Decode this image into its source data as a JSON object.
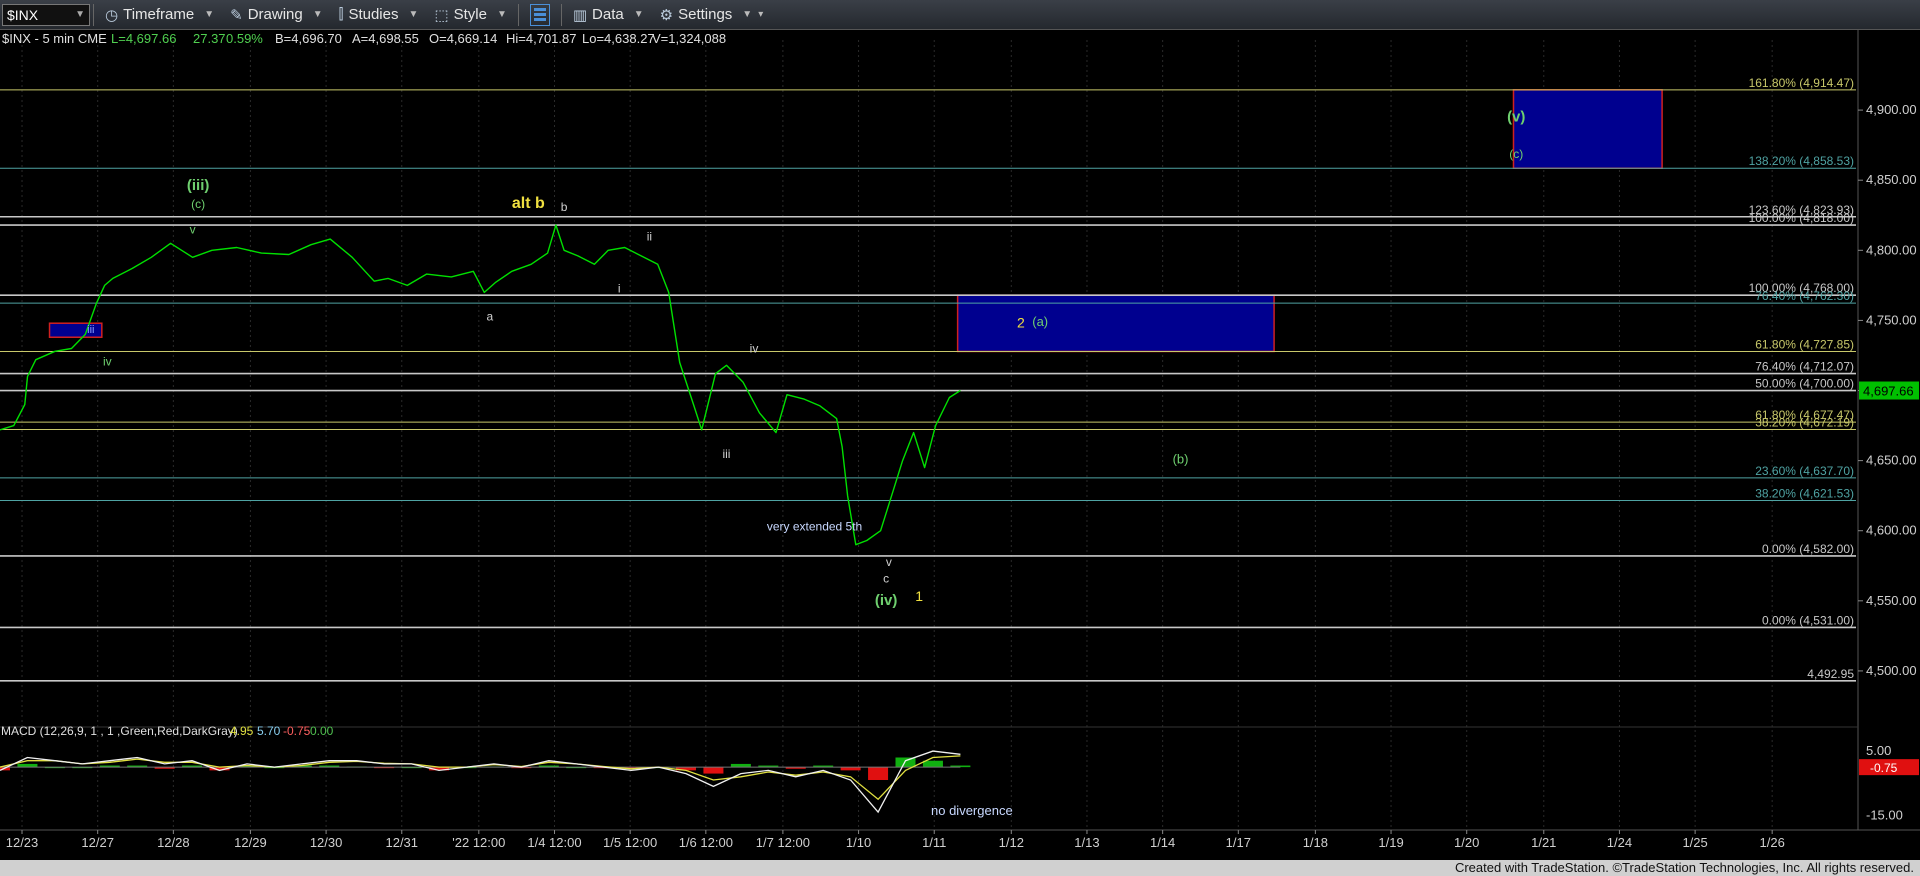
{
  "toolbar": {
    "symbol": "$INX",
    "timeframe": "Timeframe",
    "drawing": "Drawing",
    "studies": "Studies",
    "style": "Style",
    "data": "Data",
    "settings": "Settings"
  },
  "header": {
    "symbol_info": "$INX - 5 min  CME",
    "last": "L=4,697.66",
    "change": "27.37",
    "pct": "0.59%",
    "bid": "B=4,696.70",
    "ask": "A=4,698.55",
    "open": "O=4,669.14",
    "hi": "Hi=4,701.87",
    "lo": "Lo=4,638.27",
    "vol": "V=1,324,088"
  },
  "footer": "Created with TradeStation. ©TradeStation Technologies, Inc. All rights reserved.",
  "colors": {
    "price": "#00e000",
    "axis_text": "#d0d0d0",
    "fib_gray": "#c8c8c8",
    "fib_olive": "#c8c86a",
    "fib_teal": "#4fa3a3",
    "box_fill": "#00008f",
    "box_border": "#d02020"
  },
  "chart_data": [
    {
      "type": "line",
      "title": "",
      "price_axis": {
        "ylim": [
          4465,
          4950
        ],
        "ticks": [
          4900,
          4850,
          4800,
          4750,
          4700,
          4650,
          4600,
          4550,
          4500
        ],
        "tick_labels": [
          "4,900.00",
          "4,850.00",
          "4,800.00",
          "4,750.00",
          "4,700.00",
          "4,650.00",
          "4,600.00",
          "4,550.00",
          "4,500.00"
        ]
      },
      "time_axis": {
        "labels": [
          "12/23",
          "12/27",
          "12/28",
          "12/29",
          "12/30",
          "12/31",
          "'22 12:00",
          "1/4 12:00",
          "1/5 12:00",
          "1/6 12:00",
          "1/7 12:00",
          "1/10",
          "1/11",
          "1/12",
          "1/13",
          "1/14",
          "1/17",
          "1/18",
          "1/19",
          "1/20",
          "1/21",
          "1/24",
          "1/25",
          "1/26"
        ],
        "label_positions_index": [
          0.8,
          3.55,
          6.3,
          9.1,
          11.85,
          14.6,
          17.4,
          20.15,
          22.9,
          25.65,
          28.45,
          31.2,
          33.95,
          36.75,
          39.5,
          42.25,
          45.0,
          47.8,
          50.55,
          53.3,
          56.1,
          58.85,
          61.6,
          64.4
        ],
        "xlim_index": [
          0,
          66
        ]
      },
      "series": [
        {
          "points_index": [
            0,
            0.5,
            0.9,
            1.0,
            1.3,
            2.0,
            2.6,
            3.1,
            3.5,
            3.8,
            4.1,
            4.8,
            5.5,
            6.2,
            6.6,
            7.0,
            7.7,
            8.6,
            9.5,
            10.5,
            11.3,
            12.0,
            12.8,
            13.6,
            14.1,
            14.8,
            15.5,
            16.4,
            17.2,
            17.6,
            18.0,
            18.6,
            19.3,
            19.9,
            20.2,
            20.5,
            21.0,
            21.6,
            22.1,
            22.7,
            23.4,
            23.9,
            24.3,
            24.7,
            25.2,
            25.5,
            26.0,
            26.4,
            27.0,
            27.6,
            28.2,
            28.6,
            29.2,
            29.8,
            30.4,
            30.6,
            30.8,
            31.1,
            31.5,
            32.0,
            32.4,
            32.8,
            33.2,
            33.6,
            34.0,
            34.5,
            34.9
          ],
          "values": [
            4672,
            4675,
            4690,
            4710,
            4722,
            4728,
            4730,
            4740,
            4762,
            4775,
            4780,
            4787,
            4795,
            4805,
            4800,
            4795,
            4800,
            4802,
            4798,
            4797,
            4804,
            4808,
            4795,
            4778,
            4780,
            4775,
            4783,
            4781,
            4785,
            4770,
            4777,
            4785,
            4790,
            4798,
            4818,
            4800,
            4796,
            4790,
            4800,
            4802,
            4795,
            4790,
            4770,
            4720,
            4690,
            4672,
            4712,
            4718,
            4706,
            4684,
            4670,
            4697,
            4694,
            4689,
            4680,
            4660,
            4625,
            4590,
            4593,
            4600,
            4625,
            4650,
            4670,
            4645,
            4675,
            4695,
            4700
          ]
        }
      ],
      "horizontal_lines": [
        {
          "value": 4914.47,
          "label": "161.80% (4,914.47)",
          "color": "olive"
        },
        {
          "value": 4858.53,
          "label": "138.20% (4,858.53)",
          "color": "teal"
        },
        {
          "value": 4823.93,
          "label": "123.60% (4,823.93)",
          "color": "gray"
        },
        {
          "value": 4818.0,
          "label": "100.00% (4,818.00)",
          "color": "gray"
        },
        {
          "value": 4768.0,
          "label": "100.00% (4,768.00)",
          "color": "gray"
        },
        {
          "value": 4762.3,
          "label": "76.40% (4,762.30)",
          "color": "teal"
        },
        {
          "value": 4727.85,
          "label": "61.80% (4,727.85)",
          "color": "olive"
        },
        {
          "value": 4712.07,
          "label": "76.40% (4,712.07)",
          "color": "gray"
        },
        {
          "value": 4700.0,
          "label": "50.00% (4,700.00)",
          "color": "gray"
        },
        {
          "value": 4677.47,
          "label": "61.80% (4,677.47)",
          "color": "olive"
        },
        {
          "value": 4672.19,
          "label": "38.20% (4,672.19)",
          "color": "olive"
        },
        {
          "value": 4637.7,
          "label": "23.60% (4,637.70)",
          "color": "teal"
        },
        {
          "value": 4621.53,
          "label": "38.20% (4,621.53)",
          "color": "teal"
        },
        {
          "value": 4582.0,
          "label": "0.00% (4,582.00)",
          "color": "gray"
        },
        {
          "value": 4531.0,
          "label": "0.00% (4,531.00)",
          "color": "gray"
        },
        {
          "value": 4492.95,
          "label": "4,492.95",
          "color": "gray"
        }
      ],
      "current_price_tag": "4,697.66",
      "boxes": [
        {
          "x0": 55.0,
          "x1": 60.4,
          "y0": 4858.53,
          "y1": 4914.47
        },
        {
          "x0": 34.8,
          "x1": 46.3,
          "y0": 4727.85,
          "y1": 4768.0
        },
        {
          "x0": 1.8,
          "x1": 3.7,
          "y0": 4738,
          "y1": 4748
        }
      ],
      "annotations": [
        {
          "text": "(iii)",
          "x": 7.2,
          "y": 4843,
          "color": "#6fd06f",
          "size": 15
        },
        {
          "text": "(c)",
          "x": 7.2,
          "y": 4830,
          "color": "#6fd06f",
          "size": 12
        },
        {
          "text": "v",
          "x": 7.0,
          "y": 4812,
          "color": "#6fd06f",
          "size": 12
        },
        {
          "text": "iii",
          "x": 3.3,
          "y": 4741,
          "color": "#8aa0ff",
          "size": 11
        },
        {
          "text": "iv",
          "x": 3.9,
          "y": 4718,
          "color": "#6fd06f",
          "size": 12
        },
        {
          "text": "alt b",
          "x": 19.2,
          "y": 4830,
          "color": "#f0e040",
          "size": 16
        },
        {
          "text": "b",
          "x": 20.5,
          "y": 4828,
          "color": "#d0d0d0",
          "size": 12
        },
        {
          "text": "ii",
          "x": 23.6,
          "y": 4807,
          "color": "#d0d0d0",
          "size": 12
        },
        {
          "text": "a",
          "x": 17.8,
          "y": 4750,
          "color": "#d0d0d0",
          "size": 12
        },
        {
          "text": "i",
          "x": 22.5,
          "y": 4770,
          "color": "#d0d0d0",
          "size": 12
        },
        {
          "text": "iv",
          "x": 27.4,
          "y": 4727,
          "color": "#d0d0d0",
          "size": 12
        },
        {
          "text": "iii",
          "x": 26.4,
          "y": 4652,
          "color": "#d0d0d0",
          "size": 12
        },
        {
          "text": "very extended 5th",
          "x": 29.6,
          "y": 4600,
          "color": "#c8d8ff",
          "size": 12
        },
        {
          "text": "v",
          "x": 32.3,
          "y": 4575,
          "color": "#d0d0d0",
          "size": 12
        },
        {
          "text": "c",
          "x": 32.2,
          "y": 4563,
          "color": "#d0d0d0",
          "size": 12
        },
        {
          "text": "(iv)",
          "x": 32.2,
          "y": 4547,
          "color": "#6fd06f",
          "size": 15
        },
        {
          "text": "1",
          "x": 33.4,
          "y": 4550,
          "color": "#f0e040",
          "size": 14
        },
        {
          "text": "2",
          "x": 37.1,
          "y": 4745,
          "color": "#f0e040",
          "size": 14
        },
        {
          "text": "(a)",
          "x": 37.8,
          "y": 4746,
          "color": "#6fd06f",
          "size": 13
        },
        {
          "text": "(b)",
          "x": 42.9,
          "y": 4648,
          "color": "#6fd06f",
          "size": 13
        },
        {
          "text": "(v)",
          "x": 55.1,
          "y": 4892,
          "color": "#6fd06f",
          "size": 15
        },
        {
          "text": "(c)",
          "x": 55.1,
          "y": 4866,
          "color": "#6fd06f",
          "size": 12
        }
      ]
    },
    {
      "type": "line",
      "title": "",
      "indicator": "MACD",
      "params_label": "MACD (12,26,9, 1 , 1 ,Green,Red,DarkGray)",
      "values_labels": [
        "4.95",
        "5.70",
        "-0.75",
        "0.00"
      ],
      "values_colors": [
        "#e0e040",
        "#8ad0f0",
        "#ff6060",
        "#50c050"
      ],
      "ylim": [
        -18,
        10
      ],
      "ticks": [
        5,
        -15
      ],
      "tick_labels": [
        "5.00",
        "-15.00"
      ],
      "current_tag": "-0.75",
      "annotation": "no divergence",
      "x_index": [
        0,
        1,
        2,
        3,
        4,
        5,
        6,
        7,
        8,
        9,
        10,
        11,
        12,
        13,
        14,
        15,
        16,
        17,
        18,
        19,
        20,
        21,
        22,
        23,
        24,
        25,
        26,
        27,
        28,
        29,
        30,
        31,
        32,
        33,
        34,
        35
      ],
      "macd": [
        -1,
        3,
        2,
        1,
        2,
        3,
        1,
        2,
        -1,
        1,
        0,
        1,
        2,
        2,
        1,
        1,
        -1,
        0,
        1,
        0,
        2,
        1,
        0,
        -1,
        0,
        -2,
        -6,
        -2,
        -1,
        -3,
        -1,
        -4,
        -14,
        2,
        5,
        4
      ],
      "signal": [
        0,
        2,
        2,
        1,
        1.5,
        2.5,
        1.5,
        1.5,
        0,
        0.5,
        0,
        0.5,
        1.5,
        1.8,
        1.2,
        1,
        0,
        0,
        0.8,
        0.2,
        1.5,
        1,
        0.2,
        -0.5,
        0,
        -1,
        -4,
        -3,
        -1.5,
        -2.5,
        -1.5,
        -3,
        -10,
        -1,
        3,
        3.5
      ],
      "histogram": [
        -1,
        1,
        0,
        0,
        0.5,
        0.5,
        -0.5,
        0.5,
        -1,
        0.5,
        0,
        0.5,
        0.5,
        0.2,
        -0.2,
        0,
        -1,
        0,
        0.2,
        -0.2,
        0.5,
        0,
        -0.2,
        -0.5,
        0,
        -1,
        -2,
        1,
        0.5,
        -0.5,
        0.5,
        -1,
        -4,
        3,
        2,
        0.5
      ]
    }
  ]
}
